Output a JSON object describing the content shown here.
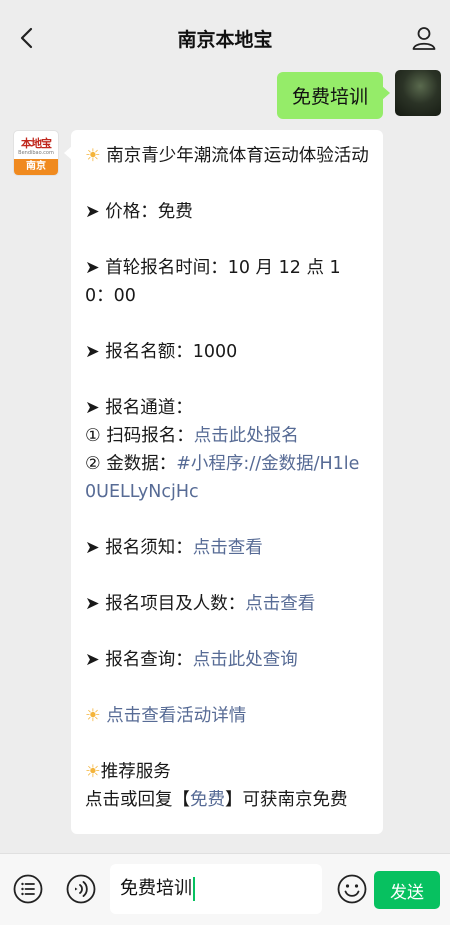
{
  "navbar": {
    "title": "南京本地宝"
  },
  "sent_message": {
    "text": "免费培训"
  },
  "official_avatar": {
    "logo_top": "本地宝",
    "logo_sub": "Bendibao.com",
    "logo_city": "南京"
  },
  "received_message": {
    "title": "南京青少年潮流体育运动体验活动",
    "price": "➤ 价格：免费",
    "reg_time": "➤ 首轮报名时间：10 月 12 点 10：00",
    "quota": "➤ 报名名额：1000",
    "channel_label": "➤ 报名通道：",
    "channel_scan_prefix": "① 扫码报名：",
    "channel_scan_link": "点击此处报名",
    "channel_data_prefix": "② 金数据：",
    "channel_data_link": "#小程序://金数据/H1le0UELLyNcjHc",
    "notice_label": "➤ 报名须知：",
    "notice_link": "点击查看",
    "items_label": "➤ 报名项目及人数：",
    "items_link": "点击查看",
    "query_label": "➤ 报名查询：",
    "query_link": "点击此处查询",
    "details_link": "点击查看活动详情",
    "recommend_title": "推荐服务",
    "recommend_text_a": "点击或回复【",
    "recommend_text_link": "免费",
    "recommend_text_b": "】可获南京免费"
  },
  "input_bar": {
    "input_value": "免费培训",
    "send_label": "发送"
  },
  "colors": {
    "background": "#ededed",
    "sent_bubble": "#95ec69",
    "link": "#576b95",
    "send_button": "#07c160"
  }
}
